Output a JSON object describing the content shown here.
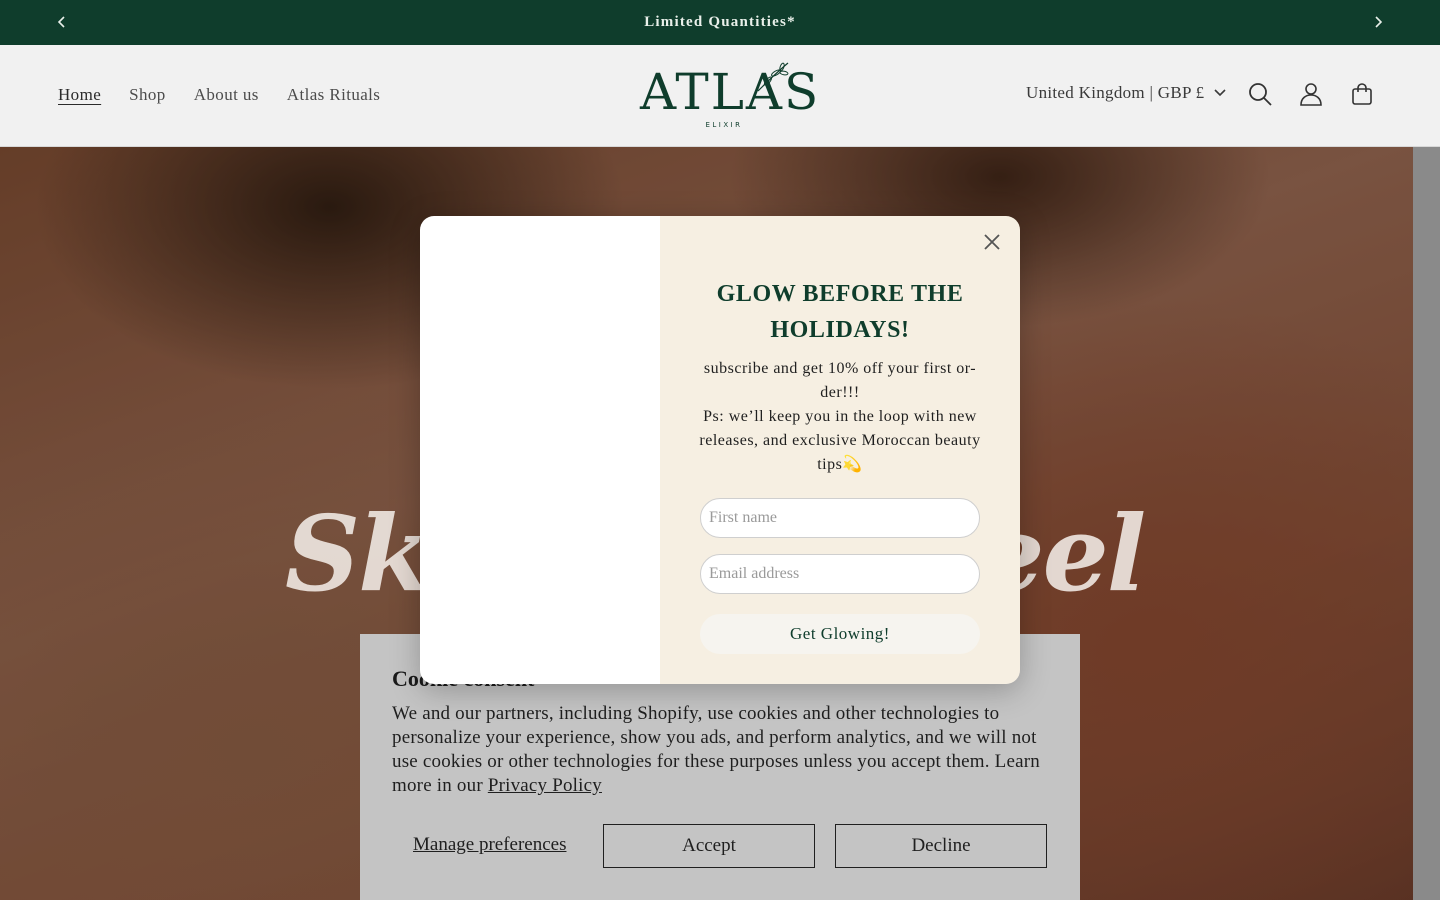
{
  "announcement": {
    "text": "Limited Quantities*",
    "prev_icon": "chevron-left-icon",
    "next_icon": "chevron-right-icon"
  },
  "header": {
    "nav": [
      "Home",
      "Shop",
      "About us",
      "Atlas Rituals"
    ],
    "active_nav": "Home",
    "logo": {
      "word": "ATLAS",
      "sub": "ELIXIR"
    },
    "country_selector": "United Kingdom | GBP £",
    "icons": [
      "search-icon",
      "account-icon",
      "cart-icon"
    ]
  },
  "hero": {
    "heading_left": "Ski",
    "heading_right": "feel"
  },
  "popup": {
    "title": "GLOW BEFORE THE HOLIDAYS!",
    "description_line1": "subscribe and get 10% off your first or-der!!!",
    "description_line2": "Ps: we’ll keep you in the loop with new releases, and exclusive Moroccan beauty tips💫",
    "first_name_placeholder": "First name",
    "email_placeholder": "Email address",
    "submit_label": "Get Glowing!"
  },
  "cookie": {
    "title": "Cookie consent",
    "text": "We and our partners, including Shopify, use cookies and other technologies to personalize your experience, show you ads, and perform analytics, and we will not use cookies or other technologies for these purposes unless you accept them. Learn more in our",
    "link": "Privacy Policy",
    "manage_label": "Manage preferences",
    "accept_label": "Accept",
    "decline_label": "Decline"
  },
  "colors": {
    "brand_green": "#0f3d2c",
    "popup_background": "#f6efe2",
    "cookie_background": "#c4c4c4"
  }
}
